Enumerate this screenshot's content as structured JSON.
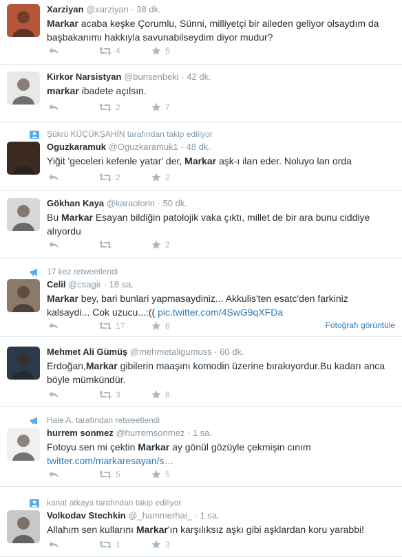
{
  "tweets": [
    {
      "context": null,
      "fullname": "Xarziyan",
      "username": "@xarziyan",
      "time": "38 dk.",
      "text_parts": [
        {
          "b": true,
          "t": "Markar"
        },
        {
          "b": false,
          "t": " acaba keşke Çorumlu, Sünni, milliyetçi bir aileden geliyor olsaydım da başbakanımı hakkıyla savunabilseydim diyor mudur?"
        }
      ],
      "retweets": "4",
      "favorites": "5",
      "avatar_color": "#b5563a"
    },
    {
      "context": null,
      "fullname": "Kirkor Narsistyan",
      "username": "@bunsenbeki",
      "time": "42 dk.",
      "text_parts": [
        {
          "b": true,
          "t": "markar"
        },
        {
          "b": false,
          "t": " ibadete açılsın."
        }
      ],
      "retweets": "2",
      "favorites": "7",
      "avatar_color": "#e8e8e8"
    },
    {
      "context": "Şükrü KÜÇÜKŞAHİN tarafından takip ediliyor",
      "fullname": "Oguzkaramuk",
      "username": "@Oguzkaramuk1",
      "time": "48 dk.",
      "text_parts": [
        {
          "b": false,
          "t": "Yiğit 'geceleri kefenle yatar' der, "
        },
        {
          "b": true,
          "t": "Markar"
        },
        {
          "b": false,
          "t": " aşk-ı ilan eder. Noluyo lan orda"
        }
      ],
      "retweets": "2",
      "favorites": "2",
      "avatar_color": "#3a2a20"
    },
    {
      "context": null,
      "fullname": "Gökhan Kaya",
      "username": "@karaolorin",
      "time": "50 dk.",
      "text_parts": [
        {
          "b": false,
          "t": "Bu "
        },
        {
          "b": true,
          "t": "Markar"
        },
        {
          "b": false,
          "t": " Esayan bildiğin patolojik vaka çıktı, millet de bir ara bunu ciddiye alıyordu"
        }
      ],
      "retweets": "",
      "favorites": "2",
      "avatar_color": "#d8d8d8"
    },
    {
      "context": "17 kez retweetlendi",
      "fullname": "Celil",
      "username": "@csagir",
      "time": "18 sa.",
      "text_parts": [
        {
          "b": true,
          "t": "Markar"
        },
        {
          "b": false,
          "t": " bey, bari bunlari yapmasaydiniz... Akkulis'ten esatc'den farkiniz kalsaydi... Cok uzucu...:(( "
        },
        {
          "b": false,
          "link": true,
          "t": "pic.twitter.com/4SwG9qXFDa"
        }
      ],
      "retweets": "17",
      "favorites": "6",
      "photo_link": "Fotoğrafı görüntüle",
      "avatar_color": "#8a7a6a"
    },
    {
      "context": null,
      "fullname": "Mehmet Ali Gümüş",
      "username": "@mehmetaligumuss",
      "time": "60 dk.",
      "text_parts": [
        {
          "b": false,
          "t": "Erdoğan,"
        },
        {
          "b": true,
          "t": "Markar"
        },
        {
          "b": false,
          "t": " gibilerin maaşını komodin üzerine bırakıyordur.Bu kadarı anca böyle mümkündür."
        }
      ],
      "retweets": "3",
      "favorites": "8",
      "avatar_color": "#2a3a4a"
    },
    {
      "context": "Hale A. tarafından retweetlendi",
      "fullname": "hurrem sonmez",
      "username": "@hurremsonmez",
      "time": "1 sa.",
      "text_parts": [
        {
          "b": false,
          "t": "Fotoyu sen mi çektin "
        },
        {
          "b": true,
          "t": "Markar"
        },
        {
          "b": false,
          "t": " ay gönül gözüyle çekmişin cınım "
        },
        {
          "b": false,
          "link": true,
          "t": "twitter.com/markaresayan/s…"
        }
      ],
      "retweets": "5",
      "favorites": "5",
      "avatar_color": "#f0f0f0"
    },
    {
      "context": "kanat atkaya tarafından takip ediliyor",
      "fullname": "Volkodav Stechkin",
      "username": "@_hammerhai_",
      "time": "1 sa.",
      "text_parts": [
        {
          "b": false,
          "t": "Allahım sen kullarını "
        },
        {
          "b": true,
          "t": "Markar"
        },
        {
          "b": false,
          "t": "'ın karşılıksız aşkı gibi aşklardan koru yarabbi!"
        }
      ],
      "retweets": "1",
      "favorites": "3",
      "avatar_color": "#c8c8c8"
    }
  ],
  "icons": {
    "reply": "reply-icon",
    "retweet": "retweet-icon",
    "favorite": "star-icon",
    "follow_context": "person-icon",
    "retweet_context": "megaphone-icon"
  },
  "colors": {
    "link": "#2b7bb9",
    "muted": "#8899a6",
    "action": "#aab8c2",
    "context_icon": "#55acee"
  }
}
